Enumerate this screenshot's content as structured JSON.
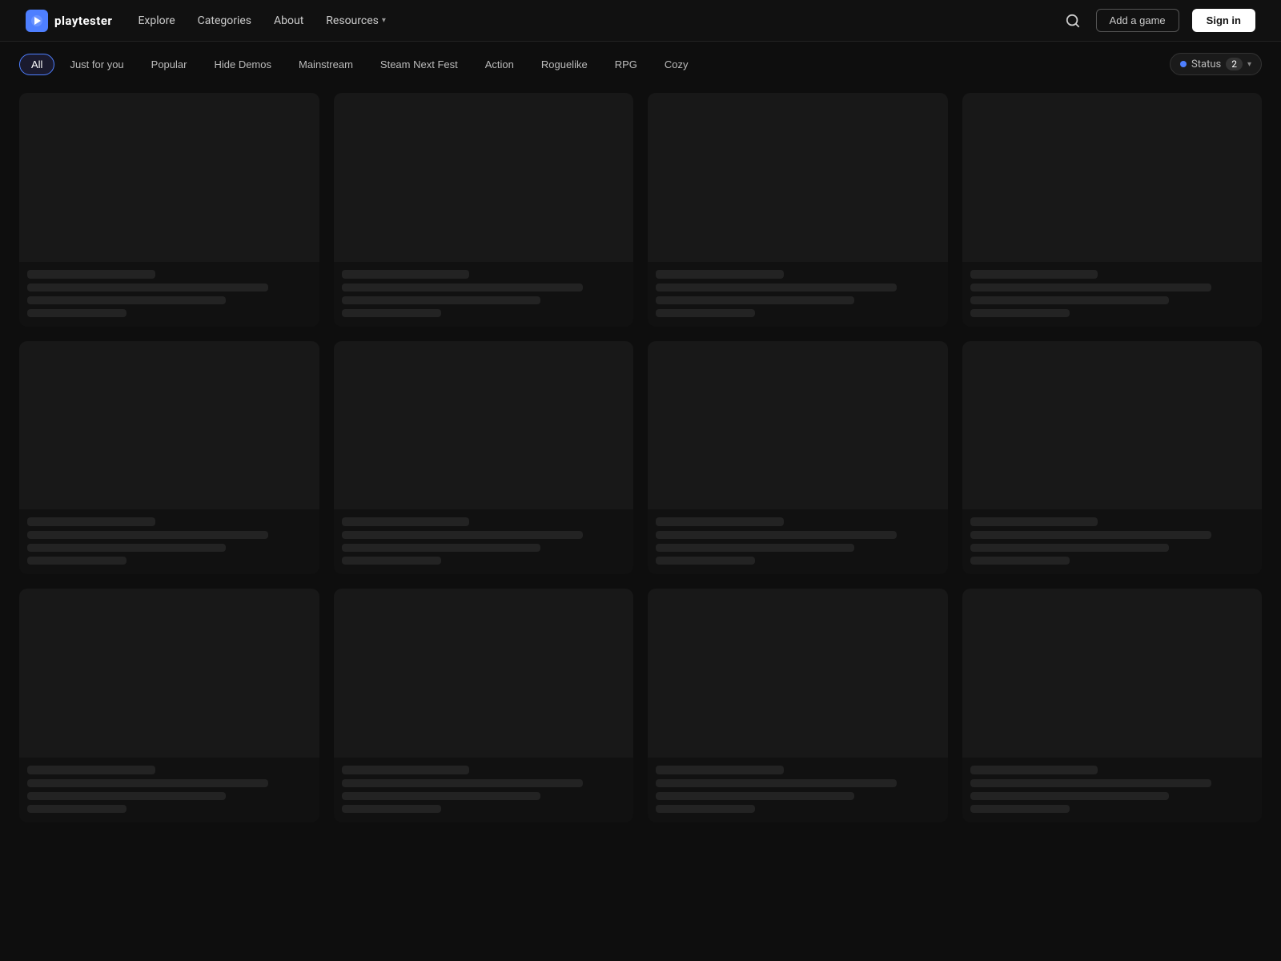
{
  "header": {
    "logo_icon": "P",
    "logo_text": "playtester",
    "nav": [
      {
        "label": "Explore",
        "id": "nav-explore"
      },
      {
        "label": "Categories",
        "id": "nav-categories"
      },
      {
        "label": "About",
        "id": "nav-about"
      },
      {
        "label": "Resources",
        "id": "nav-resources",
        "has_arrow": true
      }
    ],
    "search_label": "search",
    "add_game_label": "Add a game",
    "sign_in_label": "Sign in"
  },
  "filter_bar": {
    "pills": [
      {
        "label": "All",
        "active": true
      },
      {
        "label": "Just for you",
        "active": false
      },
      {
        "label": "Popular",
        "active": false
      },
      {
        "label": "Hide Demos",
        "active": false
      },
      {
        "label": "Mainstream",
        "active": false
      },
      {
        "label": "Steam Next Fest",
        "active": false
      },
      {
        "label": "Action",
        "active": false
      },
      {
        "label": "Roguelike",
        "active": false
      },
      {
        "label": "RPG",
        "active": false
      },
      {
        "label": "Cozy",
        "active": false
      }
    ],
    "status_label": "Status",
    "status_count": "2"
  },
  "grid": {
    "card_count": 12
  }
}
